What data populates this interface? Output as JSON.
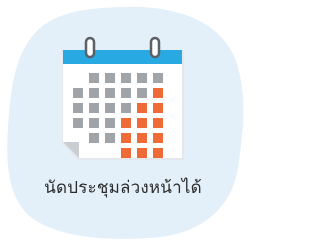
{
  "caption": "นัดประชุมล่วงหน้าได้",
  "icon": "calendar-icon",
  "colors": {
    "background_blob": "#e3f0f9",
    "calendar_header": "#29a9e1",
    "calendar_body": "#ffffff",
    "calendar_outline": "#d9dfe5",
    "day_cell": "#a0a3a7",
    "highlight_cell": "#ee6a36",
    "page_curl": "#c9ced3",
    "ring": "#5b6066",
    "caption_text": "#2b2b2b"
  }
}
